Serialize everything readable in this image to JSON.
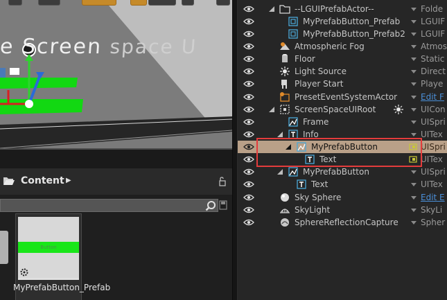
{
  "viewport": {
    "screen_text": "e Screen",
    "screen_text_far": "space U"
  },
  "content_browser": {
    "title": "Content",
    "asset": {
      "thumb_label": "Button",
      "name": "MyPrefabButton_Prefab"
    }
  },
  "outliner": {
    "rows": [
      {
        "label": "--LGUIPrefabActor--",
        "type": "Folde",
        "icon": "folder-icon"
      },
      {
        "label": "MyPrefabButton_Prefab",
        "type": "LGUIF",
        "icon": "prefab-icon"
      },
      {
        "label": "MyPrefabButton_Prefab2",
        "type": "LGUIF",
        "icon": "prefab-icon"
      },
      {
        "label": "Atmospheric Fog",
        "type": "Atmos",
        "icon": "fog-icon"
      },
      {
        "label": "Floor",
        "type": "Static",
        "icon": "static-mesh-icon"
      },
      {
        "label": "Light Source",
        "type": "Direct",
        "icon": "directional-light-icon"
      },
      {
        "label": "Player Start",
        "type": "Playe",
        "icon": "player-start-icon"
      },
      {
        "label": "PresetEventSystemActor",
        "type": "Edit F",
        "icon": "actor-icon"
      },
      {
        "label": "ScreenSpaceUIRoot",
        "type": "UICon",
        "icon": "ui-root-icon"
      },
      {
        "label": "Frame",
        "type": "UISpri",
        "icon": "sprite-icon"
      },
      {
        "label": "Info",
        "type": "UITex",
        "icon": "text-icon"
      },
      {
        "label": "MyPrefabButton",
        "type": "UISpri",
        "icon": "sprite-icon"
      },
      {
        "label": "Text",
        "type": "UITex",
        "icon": "text-icon"
      },
      {
        "label": "MyPrefabButton",
        "type": "UISpri",
        "icon": "sprite-icon"
      },
      {
        "label": "Text",
        "type": "UITex",
        "icon": "text-icon"
      },
      {
        "label": "Sky Sphere",
        "type": "Edit E",
        "icon": "sky-sphere-icon"
      },
      {
        "label": "SkyLight",
        "type": "SkyLi",
        "icon": "sky-light-icon"
      },
      {
        "label": "SphereReflectionCapture",
        "type": "Spher",
        "icon": "reflection-capture-icon"
      }
    ]
  },
  "colors": {
    "selected_row": "#b9a088",
    "highlight_border": "#e43c3c",
    "link": "#4a8fd8",
    "accent_orange": "#c58a2a",
    "button_green": "#19e619"
  }
}
